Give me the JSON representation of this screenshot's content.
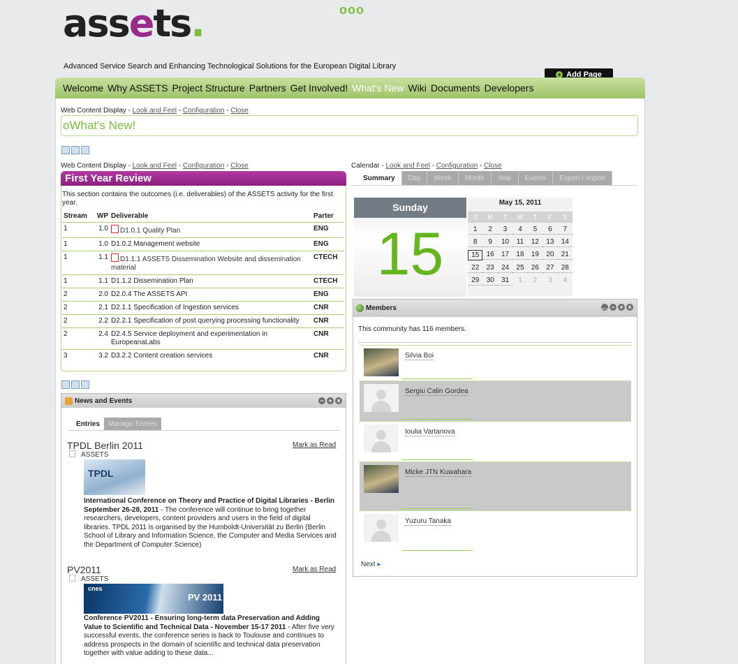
{
  "site": {
    "logo_a": "ass",
    "logo_at": "e",
    "logo_b": "ts",
    "logo_dot": ".",
    "logo_circles": "ooo",
    "tagline": "Advanced Service Search and Enhancing Technological Solutions for the European Digital Library",
    "add_page": "Add Page"
  },
  "nav": [
    "Welcome",
    "Why ASSETS",
    "Project Structure",
    "Partners",
    "Get Involved!",
    "What's New",
    "Wiki",
    "Documents",
    "Developers"
  ],
  "nav_active": "What's New",
  "portlet_top": {
    "name": "Web Content Display",
    "look": "Look and Feel",
    "config": "Configuration",
    "close": "Close",
    "sep": " - "
  },
  "whats_new": {
    "bullet": "o",
    "title": "What's New!"
  },
  "portlet_review": {
    "name": "Web Content Display",
    "look": "Look and Feel",
    "config": "Configuration",
    "close": "Close"
  },
  "review": {
    "title": "First Year Review",
    "intro": "This section contains the outcomes (i.e. deliverables) of the ASSETS activity for the first year.",
    "headers": [
      "Stream",
      "WP",
      "Deliverable",
      "Parter"
    ],
    "rows": [
      {
        "stream": "1",
        "wp": "1.0",
        "deliverable": "D1.0.1 Quality Plan",
        "partner": "ENG",
        "pdf": true,
        "link": true
      },
      {
        "stream": "1",
        "wp": "1.0",
        "deliverable": "D1.0.2 Management website",
        "partner": "ENG",
        "pdf": false,
        "link": false
      },
      {
        "stream": "1",
        "wp": "1.1",
        "deliverable": "D1.1.1 ASSETS Dissemination Website and dissemination material",
        "partner": "CTECH",
        "pdf": true,
        "link": true
      },
      {
        "stream": "1",
        "wp": "1.1",
        "deliverable": "D1.1.2 Dissemination Plan",
        "partner": "CTECH",
        "pdf": false,
        "link": false
      },
      {
        "stream": "2",
        "wp": "2.0",
        "deliverable": "D2.0.4 The ASSETS API",
        "partner": "ENG",
        "pdf": false,
        "link": false
      },
      {
        "stream": "2",
        "wp": "2.1",
        "deliverable": "D2.1.1 Specification of Ingestion services",
        "partner": "CNR",
        "pdf": false,
        "link": false
      },
      {
        "stream": "2",
        "wp": "2.2",
        "deliverable": "D2.2.1 Specification of post querying processing functionality",
        "partner": "CNR",
        "pdf": false,
        "link": false
      },
      {
        "stream": "2",
        "wp": "2.4",
        "deliverable": "D2.4.5 Service deployment and experimentation in EuropeanaLabs",
        "partner": "CNR",
        "pdf": false,
        "link": false
      },
      {
        "stream": "3",
        "wp": "3.2",
        "deliverable": "D3.2.2 Content creation services",
        "partner": "CNR",
        "pdf": false,
        "link": false
      }
    ]
  },
  "portlet_calendar": {
    "name": "Calendar",
    "look": "Look and Feel",
    "config": "Configuration",
    "close": "Close"
  },
  "calendar": {
    "tabs": [
      "Summary",
      "Day",
      "Week",
      "Month",
      "Year",
      "Events",
      "Export / Import"
    ],
    "weekday": "Sunday",
    "day": "15",
    "month_title": "May 15, 2011",
    "dow": [
      "S",
      "M",
      "T",
      "W",
      "T",
      "F",
      "S"
    ],
    "days": [
      "1",
      "2",
      "3",
      "4",
      "5",
      "6",
      "7",
      "8",
      "9",
      "10",
      "11",
      "12",
      "13",
      "14",
      "15",
      "16",
      "17",
      "18",
      "19",
      "20",
      "21",
      "22",
      "23",
      "24",
      "25",
      "26",
      "27",
      "28",
      "29",
      "30",
      "31",
      "1",
      "2",
      "3",
      "4"
    ]
  },
  "members": {
    "title": "Members",
    "count_text": "This community has 116 members.",
    "list": [
      "Silvia Boi",
      "Sergiu Calin Gordea",
      "Ioulia Vartanova",
      "Micke JTN Kuwahara",
      "Yuzuru Tanaka"
    ],
    "next": "Next"
  },
  "news": {
    "title": "News and Events",
    "tabs": [
      "Entries",
      "Manage Entries"
    ],
    "mark_read": "Mark as Read",
    "entries": [
      {
        "title": "TPDL Berlin 2011",
        "tag": "ASSETS",
        "thumb_label": "TPDL",
        "bold": "International Conference on Theory and Practice of Digital Libraries - Berlin September 26-28, 2011",
        "body": " - The conference will continue to bring together researchers, developers, content providers and users in the field of digital libraries. TPDL 2011 is organised by the Humboldt-Universität zu Berlin (Berlin School of Library and Information Science, the Computer and Media Services and the Department of Computer Science)"
      },
      {
        "title": "PV2011",
        "tag": "ASSETS",
        "thumb_brand": "cnes",
        "thumb_label": "PV 2011",
        "bold": "Conference PV2011 - Ensuring long-term data Preservation and Adding Value to Scientific and Technical Data - November 15-17 2011",
        "body": " - After five very successful events, the conference series is back to Toulouse and continues to address prospects in the domain of scientific and technical data preservation together with value adding to these data..."
      }
    ]
  }
}
